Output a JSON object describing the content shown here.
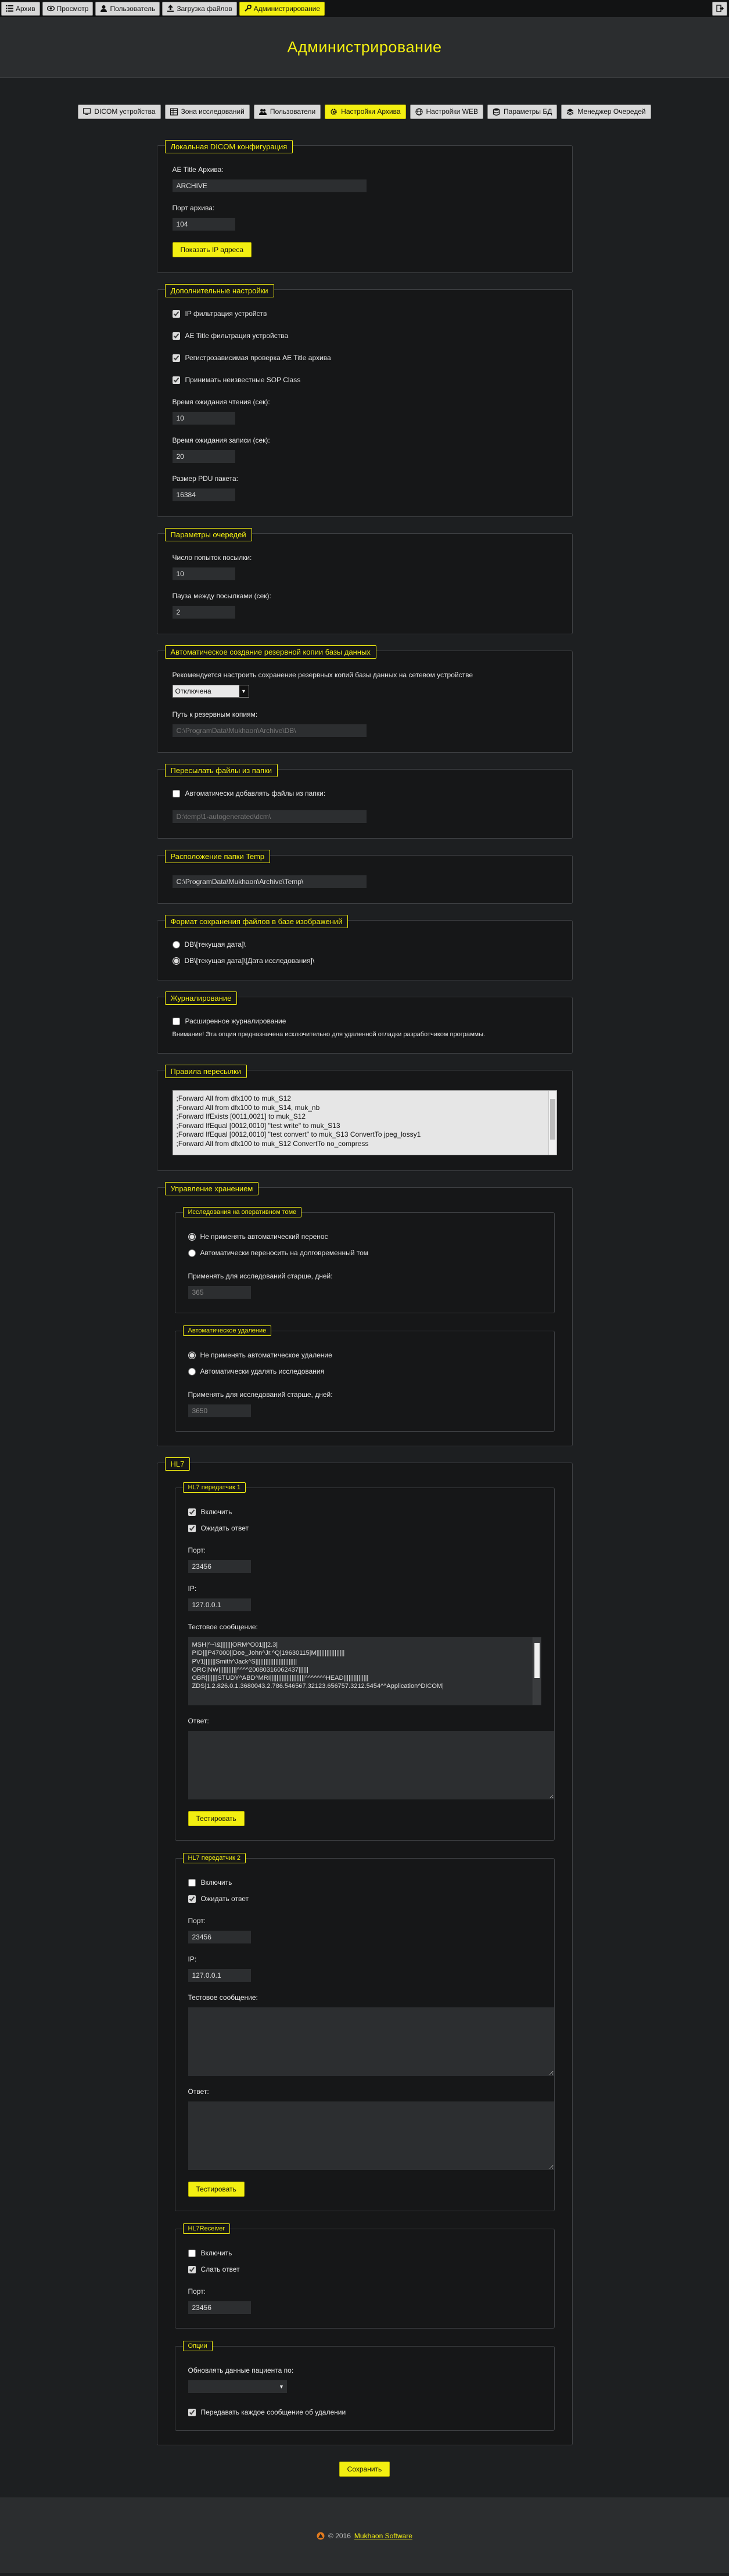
{
  "topnav": {
    "items": [
      {
        "label": "Архив",
        "icon": "list-icon"
      },
      {
        "label": "Просмотр",
        "icon": "eye-icon"
      },
      {
        "label": "Пользователь",
        "icon": "user-icon"
      },
      {
        "label": "Загрузка файлов",
        "icon": "upload-icon"
      },
      {
        "label": "Администрирование",
        "icon": "wrench-icon",
        "active": true
      }
    ],
    "exit_icon": "logout-icon"
  },
  "page_title": "Администрирование",
  "tabs": [
    {
      "label": "DICOM устройства",
      "icon": "monitor-icon"
    },
    {
      "label": "Зона исследований",
      "icon": "table-icon"
    },
    {
      "label": "Пользователи",
      "icon": "users-icon"
    },
    {
      "label": "Настройки Архива",
      "icon": "gear-icon",
      "active": true
    },
    {
      "label": "Настройки WEB",
      "icon": "globe-icon"
    },
    {
      "label": "Параметры БД",
      "icon": "database-icon"
    },
    {
      "label": "Менеджер Очередей",
      "icon": "queue-icon"
    }
  ],
  "local_dicom": {
    "title": "Локальная DICOM конфигурация",
    "ae_title_label": "AE Title Архива:",
    "ae_title_value": "ARCHIVE",
    "port_label": "Порт архива:",
    "port_value": "104",
    "show_ip_button": "Показать IP адреса"
  },
  "extra": {
    "title": "Дополнительные настройки",
    "checkboxes": [
      {
        "label": "IP фильтрация устройств",
        "checked": true
      },
      {
        "label": "AE Title фильтрация устройства",
        "checked": true
      },
      {
        "label": "Регистрозависимая проверка AE Title архива",
        "checked": true
      },
      {
        "label": "Принимать неизвестные SOP Class",
        "checked": true
      }
    ],
    "read_timeout_label": "Время ожидания чтения (сек):",
    "read_timeout_value": "10",
    "write_timeout_label": "Время ожидания записи (сек):",
    "write_timeout_value": "20",
    "pdu_label": "Размер PDU пакета:",
    "pdu_value": "16384"
  },
  "queue": {
    "title": "Параметры очередей",
    "attempts_label": "Число попыток посылки:",
    "attempts_value": "10",
    "pause_label": "Пауза между посылками (сек):",
    "pause_value": "2"
  },
  "backup": {
    "title": "Автоматическое создание резервной копии базы данных",
    "description": "Рекомендуется настроить сохранение резервных копий базы данных на сетевом устройстве",
    "select_value": "Отключена",
    "path_label": "Путь к резервным копиям:",
    "path_placeholder": "C:\\ProgramData\\Mukhaon\\Archive\\DB\\"
  },
  "forward_files": {
    "title": "Пересылать файлы из папки",
    "checkbox_label": "Автоматически добавлять файлы из папки:",
    "path_placeholder": "D:\\temp\\1-autogenerated\\dcm\\"
  },
  "temp": {
    "title": "Расположение папки Temp",
    "path_value": "C:\\ProgramData\\Mukhaon\\Archive\\Temp\\"
  },
  "storage_format": {
    "title": "Формат сохранения файлов в базе изображений",
    "options": [
      {
        "label": "DB\\[текущая дата]\\",
        "checked": false
      },
      {
        "label": "DB\\[текущая дата]\\[Дата исследования]\\",
        "checked": true
      }
    ]
  },
  "logging": {
    "title": "Журналирование",
    "checkbox_label": "Расширенное журналирование",
    "warning": "Внимание! Эта опция предназначена исключительно для удаленной отладки разработчиком программы."
  },
  "forward_rules": {
    "title": "Правила пересылки",
    "lines": [
      ";Forward All from dfx100 to muk_S12",
      ";Forward All from dfx100 to muk_S14, muk_nb",
      ";Forward IfExists [0011,0021] to muk_S12",
      ";Forward IfEqual [0012,0010] \"test write\" to muk_S13",
      ";Forward IfEqual [0012,0010] \"test convert\" to muk_S13 ConvertTo jpeg_lossy1",
      ";Forward All from dfx100 to muk_S12 ConvertTo no_compress"
    ]
  },
  "retention": {
    "title": "Управление хранением",
    "online": {
      "title": "Исследования на оперативном томе",
      "options": [
        {
          "label": "Не применять автоматический перенос",
          "checked": true
        },
        {
          "label": "Автоматически переносить на долговременный том",
          "checked": false
        }
      ],
      "days_label": "Применять для исследований старше, дней:",
      "days_value": "365"
    },
    "auto_delete": {
      "title": "Автоматическое удаление",
      "options": [
        {
          "label": "Не применять автоматическое удаление",
          "checked": true
        },
        {
          "label": "Автоматически удалять исследования",
          "checked": false
        }
      ],
      "days_label": "Применять для исследований старше, дней:",
      "days_value": "3650"
    }
  },
  "hl7": {
    "title": "HL7",
    "sender1": {
      "title": "HL7 передатчик 1",
      "enable_label": "Включить",
      "wait_label": "Ожидать ответ",
      "port_label": "Порт:",
      "port_value": "23456",
      "ip_label": "IP:",
      "ip_value": "127.0.0.1",
      "test_label": "Тестовое сообщение:",
      "test_lines": [
        "MSH|^~\\&|||||||ORM^O01|||2.3|",
        "PID|||P47000||Doe_John^Jr.^Q|19630115|M|||||||||||||||||",
        "PV1|||||||Smith^Jack^S|||||||||||||||||||||||||",
        "ORC|NW|||||||||||^^^^20080316062437||||||",
        "OBR|||||||STUDY^ABD^MRI|||||||||||||||||||||^^^^^^^HEAD|||||||||||||||",
        "ZDS|1.2.826.0.1.3680043.2.786.546567.32123.656757.3212.5454^^Application^DICOM|"
      ],
      "response_label": "Ответ:",
      "test_button": "Тестировать"
    },
    "sender2": {
      "title": "HL7 передатчик 2",
      "enable_label": "Включить",
      "wait_label": "Ожидать ответ",
      "port_label": "Порт:",
      "port_value": "23456",
      "ip_label": "IP:",
      "ip_value": "127.0.0.1",
      "test_label": "Тестовое сообщение:",
      "response_label": "Ответ:",
      "test_button": "Тестировать"
    },
    "receiver": {
      "title": "HL7Receiver",
      "enable_label": "Включить",
      "send_label": "Слать ответ",
      "port_label": "Порт:",
      "port_value": "23456"
    },
    "options": {
      "title": "Опции",
      "update_label": "Обновлять данные пациента по:",
      "update_value": "",
      "send_each_label": "Передавать каждое сообщение об удалении"
    }
  },
  "save_button": "Сохранить",
  "footer": {
    "copyright": "© 2016",
    "link": "Mukhaon Software"
  }
}
